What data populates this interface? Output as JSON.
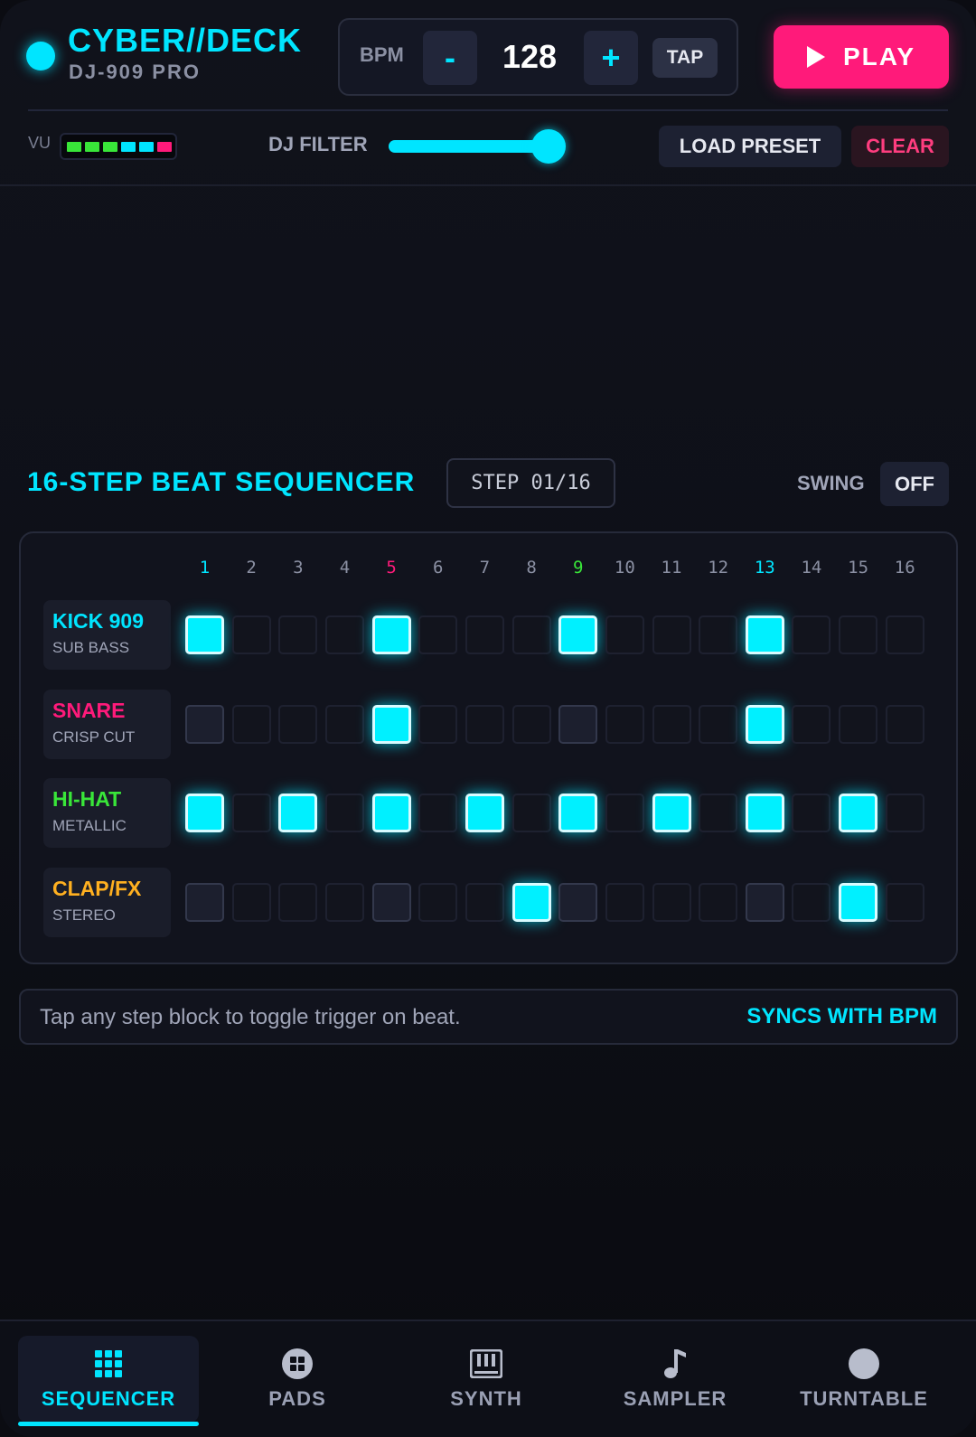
{
  "header": {
    "title": "CYBER//DECK",
    "subtitle": "DJ-909 PRO",
    "bpm_label": "BPM",
    "bpm_minus": "-",
    "bpm_value": "128",
    "bpm_plus": "+",
    "tap_label": "TAP",
    "play_label": "PLAY",
    "accent_color": "#00e5ff",
    "play_color": "#ff1a7a"
  },
  "controls": {
    "vu_label": "VU",
    "vu_segments": [
      "#39e639",
      "#39e639",
      "#39e639",
      "#00e5ff",
      "#00e5ff",
      "#ff1a7a"
    ],
    "filter_label": "DJ FILTER",
    "filter_value": 0.93,
    "load_preset_label": "LOAD PRESET",
    "clear_label": "CLEAR"
  },
  "sequencer": {
    "title": "16-STEP BEAT SEQUENCER",
    "step_indicator": "STEP 01/16",
    "swing_label": "SWING",
    "swing_value": "OFF",
    "step_numbers": [
      "1",
      "2",
      "3",
      "4",
      "5",
      "6",
      "7",
      "8",
      "9",
      "10",
      "11",
      "12",
      "13",
      "14",
      "15",
      "16"
    ],
    "step_number_colors": {
      "1": "#00e5ff",
      "5": "#ff1a7a",
      "9": "#39e639",
      "13": "#00e5ff"
    },
    "tracks": [
      {
        "name": "KICK 909",
        "sub": "SUB BASS",
        "color": "#00e5ff",
        "steps": [
          1,
          0,
          0,
          0,
          1,
          0,
          0,
          0,
          1,
          0,
          0,
          0,
          1,
          0,
          0,
          0
        ],
        "ghost": [
          0,
          0,
          0,
          0,
          0,
          0,
          0,
          0,
          0,
          0,
          0,
          0,
          0,
          0,
          0,
          0
        ]
      },
      {
        "name": "SNARE",
        "sub": "CRISP CUT",
        "color": "#ff1a7a",
        "steps": [
          0,
          0,
          0,
          0,
          1,
          0,
          0,
          0,
          0,
          0,
          0,
          0,
          1,
          0,
          0,
          0
        ],
        "ghost": [
          1,
          0,
          0,
          0,
          0,
          0,
          0,
          0,
          1,
          0,
          0,
          0,
          0,
          0,
          0,
          0
        ]
      },
      {
        "name": "HI-HAT",
        "sub": "METALLIC",
        "color": "#39e639",
        "steps": [
          1,
          0,
          1,
          0,
          1,
          0,
          1,
          0,
          1,
          0,
          1,
          0,
          1,
          0,
          1,
          0
        ],
        "ghost": [
          0,
          0,
          0,
          0,
          0,
          0,
          0,
          0,
          0,
          0,
          0,
          0,
          0,
          0,
          0,
          0
        ]
      },
      {
        "name": "CLAP/FX",
        "sub": "STEREO",
        "color": "#ffb020",
        "steps": [
          0,
          0,
          0,
          0,
          0,
          0,
          0,
          1,
          0,
          0,
          0,
          0,
          0,
          0,
          1,
          0
        ],
        "ghost": [
          1,
          0,
          0,
          0,
          1,
          0,
          0,
          0,
          1,
          0,
          0,
          0,
          1,
          0,
          0,
          0
        ]
      }
    ]
  },
  "hint": {
    "text": "Tap any step block to toggle trigger on beat.",
    "sync": "SYNCS WITH BPM"
  },
  "nav": {
    "items": [
      {
        "label": "SEQUENCER",
        "icon": "grid-icon",
        "active": true
      },
      {
        "label": "PADS",
        "icon": "pads-icon",
        "active": false
      },
      {
        "label": "SYNTH",
        "icon": "piano-keys-icon",
        "active": false
      },
      {
        "label": "SAMPLER",
        "icon": "music-note-icon",
        "active": false
      },
      {
        "label": "TURNTABLE",
        "icon": "record-disc-icon",
        "active": false
      }
    ]
  }
}
